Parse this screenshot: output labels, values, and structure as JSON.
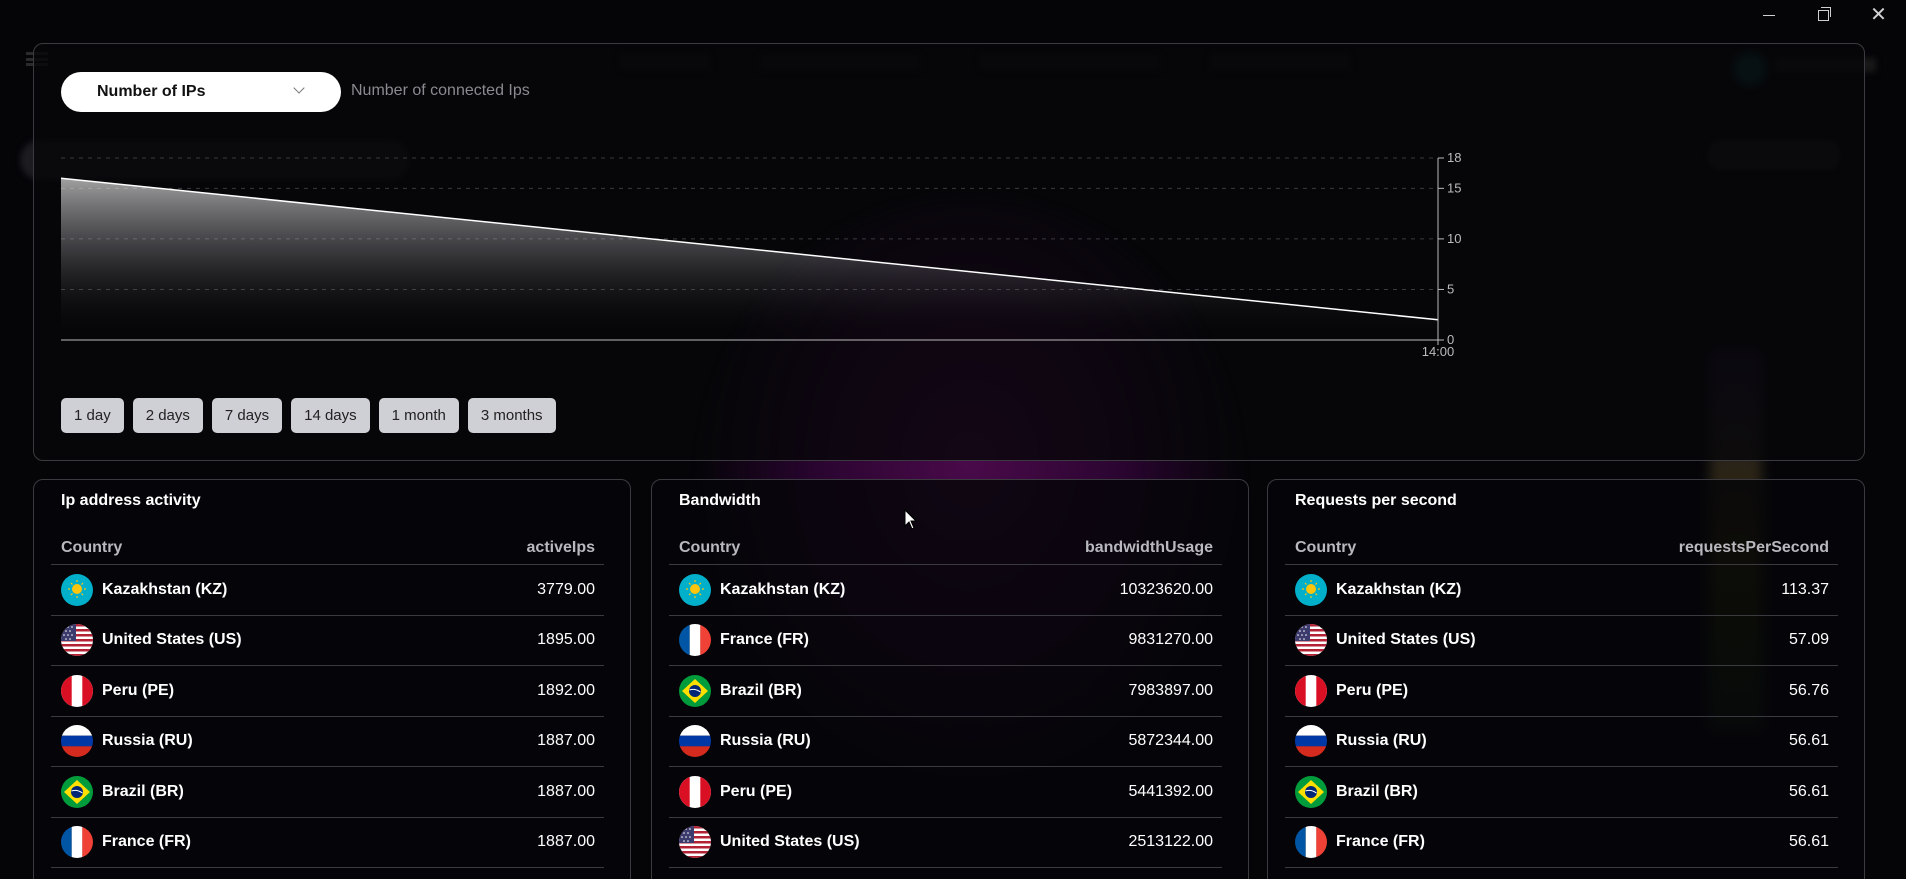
{
  "window": {
    "minimize_icon": "minimize-icon",
    "restore_icon": "restore-icon",
    "close_icon": "close-icon"
  },
  "chart_panel": {
    "metric_select": "Number of IPs",
    "subtitle": "Number of connected Ips",
    "ranges": [
      "1 day",
      "2 days",
      "7 days",
      "14 days",
      "1 month",
      "3 months"
    ]
  },
  "chart_data": {
    "type": "area",
    "title": "",
    "xlabel": "",
    "ylabel": "",
    "x_ticks": [
      "14:00"
    ],
    "y_ticks": [
      0,
      5,
      10,
      15,
      18
    ],
    "ylim": [
      0,
      18
    ],
    "grid": true,
    "series": [
      {
        "values": [
          16,
          2
        ]
      }
    ]
  },
  "tables": [
    {
      "title": "Ip address activity",
      "col_country": "Country",
      "col_value": "activeIps",
      "rows": [
        {
          "flag": "kz",
          "country": "Kazakhstan (KZ)",
          "value": "3779.00"
        },
        {
          "flag": "us",
          "country": "United States (US)",
          "value": "1895.00"
        },
        {
          "flag": "pe",
          "country": "Peru (PE)",
          "value": "1892.00"
        },
        {
          "flag": "ru",
          "country": "Russia (RU)",
          "value": "1887.00"
        },
        {
          "flag": "br",
          "country": "Brazil (BR)",
          "value": "1887.00"
        },
        {
          "flag": "fr",
          "country": "France (FR)",
          "value": "1887.00"
        }
      ]
    },
    {
      "title": "Bandwidth",
      "col_country": "Country",
      "col_value": "bandwidthUsage",
      "rows": [
        {
          "flag": "kz",
          "country": "Kazakhstan (KZ)",
          "value": "10323620.00"
        },
        {
          "flag": "fr",
          "country": "France (FR)",
          "value": "9831270.00"
        },
        {
          "flag": "br",
          "country": "Brazil (BR)",
          "value": "7983897.00"
        },
        {
          "flag": "ru",
          "country": "Russia (RU)",
          "value": "5872344.00"
        },
        {
          "flag": "pe",
          "country": "Peru (PE)",
          "value": "5441392.00"
        },
        {
          "flag": "us",
          "country": "United States (US)",
          "value": "2513122.00"
        }
      ]
    },
    {
      "title": "Requests per second",
      "col_country": "Country",
      "col_value": "requestsPerSecond",
      "rows": [
        {
          "flag": "kz",
          "country": "Kazakhstan (KZ)",
          "value": "113.37"
        },
        {
          "flag": "us",
          "country": "United States (US)",
          "value": "57.09"
        },
        {
          "flag": "pe",
          "country": "Peru (PE)",
          "value": "56.76"
        },
        {
          "flag": "ru",
          "country": "Russia (RU)",
          "value": "56.61"
        },
        {
          "flag": "br",
          "country": "Brazil (BR)",
          "value": "56.61"
        },
        {
          "flag": "fr",
          "country": "France (FR)",
          "value": "56.61"
        }
      ]
    }
  ]
}
